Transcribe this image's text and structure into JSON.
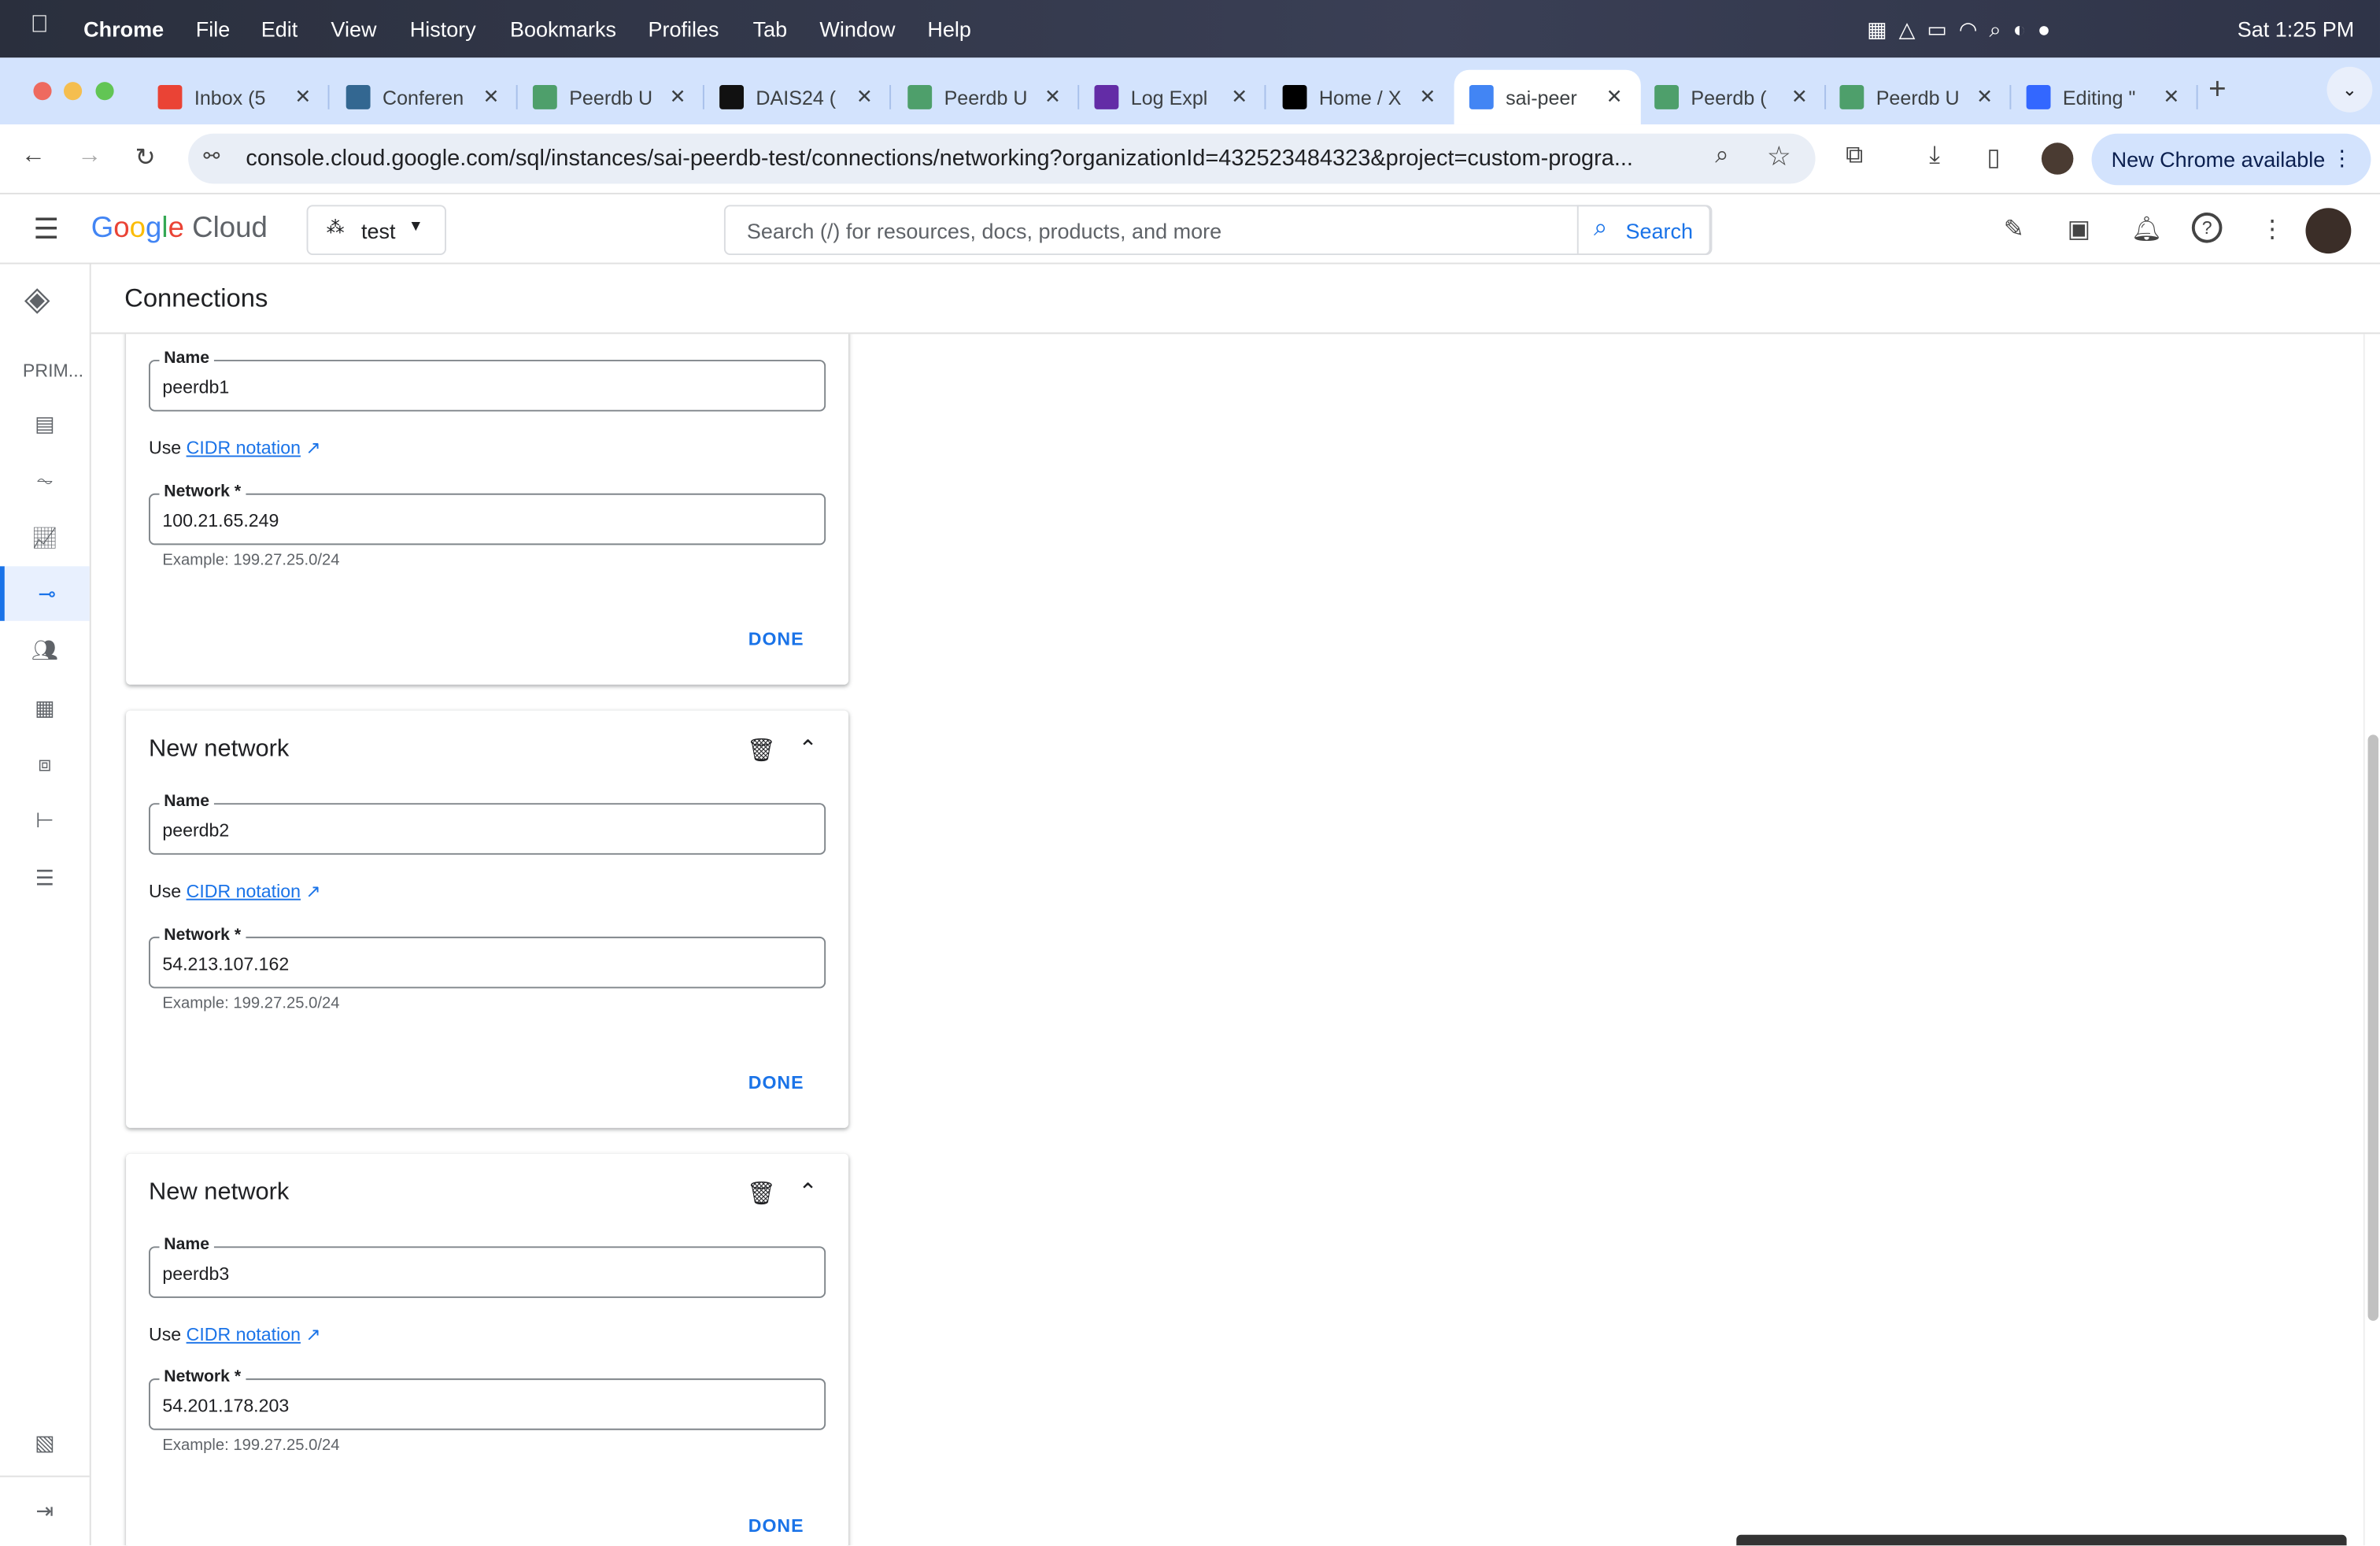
{
  "menubar": {
    "app": "Chrome",
    "items": [
      "File",
      "Edit",
      "View",
      "History",
      "Bookmarks",
      "Profiles",
      "Tab",
      "Window",
      "Help"
    ],
    "clock": "Sat 1:25 PM"
  },
  "tabs": [
    {
      "title": "Inbox (5",
      "color": "#ea4335"
    },
    {
      "title": "Conferen",
      "color": "#336791"
    },
    {
      "title": "Peerdb U",
      "color": "#4e9f6b"
    },
    {
      "title": "DAIS24 (",
      "color": "#111111"
    },
    {
      "title": "Peerdb U",
      "color": "#4e9f6b"
    },
    {
      "title": "Log Expl",
      "color": "#632ca6"
    },
    {
      "title": "Home / X",
      "color": "#000000"
    },
    {
      "title": "sai-peer",
      "color": "#4285f4",
      "active": true
    },
    {
      "title": "Peerdb (",
      "color": "#4e9f6b"
    },
    {
      "title": "Peerdb U",
      "color": "#4e9f6b"
    },
    {
      "title": "Editing \"",
      "color": "#3367ff"
    }
  ],
  "browser": {
    "url": "console.cloud.google.com/sql/instances/sai-peerdb-test/connections/networking?organizationId=432523484323&project=custom-progra...",
    "new_chrome": "New Chrome available"
  },
  "gcp": {
    "logo": "Google Cloud",
    "project": "test",
    "search_placeholder": "Search (/) for resources, docs, products, and more",
    "search_button": "Search"
  },
  "page": {
    "title": "Connections",
    "sidebar_section": "PRIM..."
  },
  "cards": [
    {
      "name_label": "Name",
      "name_value": "peerdb1",
      "cidr_prefix": "Use",
      "cidr_link": "CIDR notation",
      "network_label": "Network *",
      "network_value": "100.21.65.249",
      "example": "Example: 199.27.25.0/24",
      "done": "DONE"
    },
    {
      "title": "New network",
      "name_label": "Name",
      "name_value": "peerdb2",
      "cidr_prefix": "Use",
      "cidr_link": "CIDR notation",
      "network_label": "Network *",
      "network_value": "54.213.107.162",
      "example": "Example: 199.27.25.0/24",
      "done": "DONE"
    },
    {
      "title": "New network",
      "name_label": "Name",
      "name_value": "peerdb3",
      "cidr_prefix": "Use",
      "cidr_link": "CIDR notation",
      "network_label": "Network *",
      "network_value": "54.201.178.203",
      "example": "Example: 199.27.25.0/24",
      "done": "DONE"
    }
  ],
  "colors": {
    "accent": "#1a73e8",
    "tabstrip": "#d3e3fd"
  }
}
